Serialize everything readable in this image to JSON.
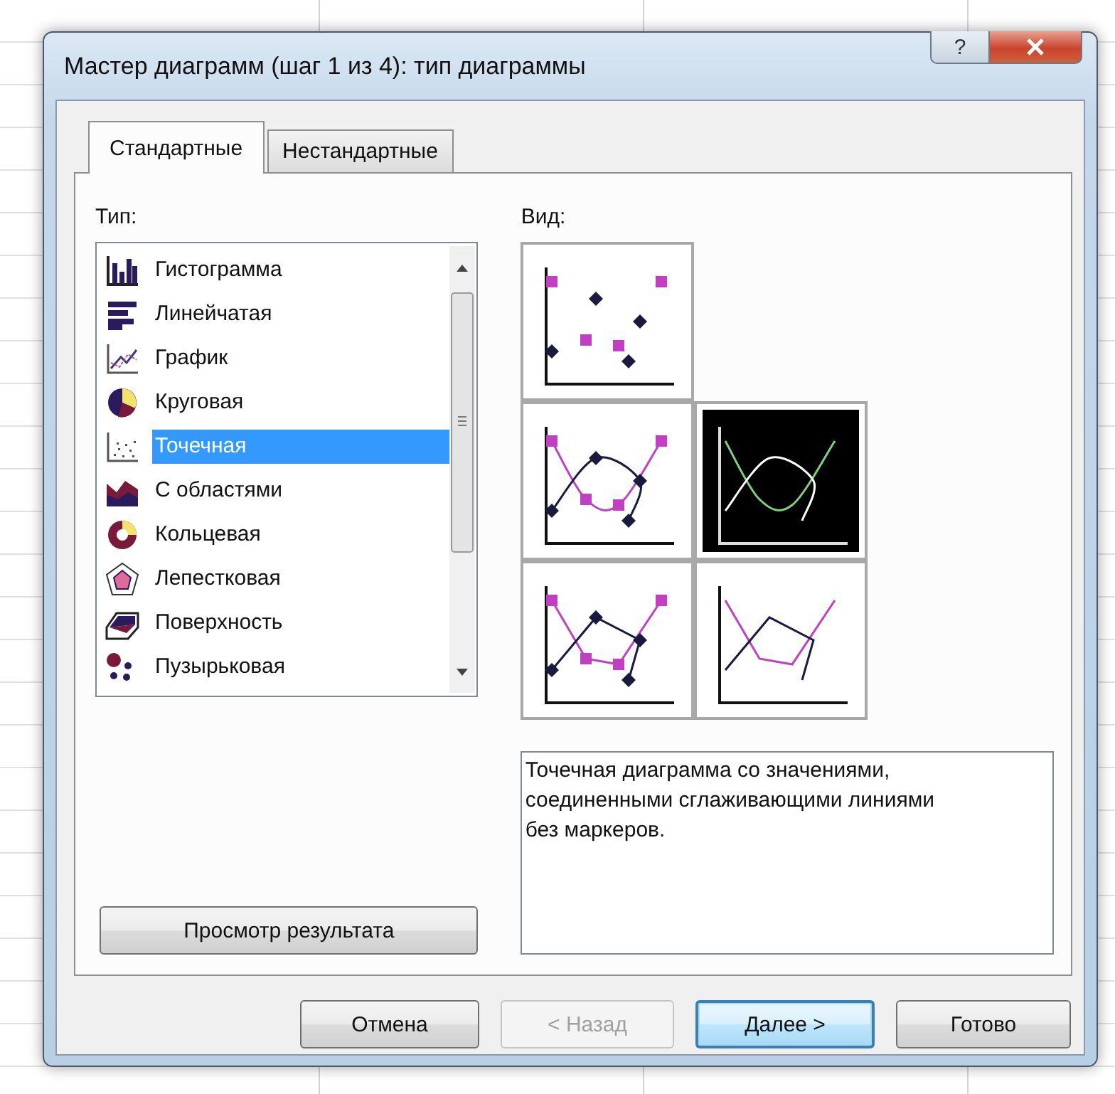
{
  "window": {
    "title": "Мастер диаграмм (шаг 1 из 4): тип диаграммы",
    "help_symbol": "?"
  },
  "tabs": [
    {
      "label": "Стандартные",
      "selected": true
    },
    {
      "label": "Нестандартные",
      "selected": false
    }
  ],
  "chart_types": {
    "label": "Тип:",
    "items": [
      {
        "label": "Гистограмма",
        "kind": "column",
        "selected": false
      },
      {
        "label": "Линейчатая",
        "kind": "bar",
        "selected": false
      },
      {
        "label": "График",
        "kind": "line",
        "selected": false
      },
      {
        "label": "Круговая",
        "kind": "pie",
        "selected": false
      },
      {
        "label": "Точечная",
        "kind": "scatter",
        "selected": true
      },
      {
        "label": "С областями",
        "kind": "area",
        "selected": false
      },
      {
        "label": "Кольцевая",
        "kind": "doughnut",
        "selected": false
      },
      {
        "label": "Лепестковая",
        "kind": "radar",
        "selected": false
      },
      {
        "label": "Поверхность",
        "kind": "surface",
        "selected": false
      },
      {
        "label": "Пузырьковая",
        "kind": "bubble",
        "selected": false
      }
    ]
  },
  "subtypes": {
    "label": "Вид:",
    "rows": [
      [
        {
          "kind": "markers",
          "selected": false
        }
      ],
      [
        {
          "kind": "smooth-markers",
          "selected": false
        },
        {
          "kind": "smooth",
          "selected": true
        }
      ],
      [
        {
          "kind": "lines-markers",
          "selected": false
        },
        {
          "kind": "lines",
          "selected": false
        }
      ]
    ]
  },
  "description_lines": [
    "Точечная диаграмма со значениями,",
    "соединенными сглаживающими линиями",
    "без маркеров."
  ],
  "preview_button": "Просмотр результата",
  "buttons": [
    {
      "label": "Отмена",
      "disabled": false,
      "default": false
    },
    {
      "label": "< Назад",
      "disabled": true,
      "default": false
    },
    {
      "label": "Далее >",
      "disabled": false,
      "default": true
    },
    {
      "label": "Готово",
      "disabled": false,
      "default": false
    }
  ]
}
